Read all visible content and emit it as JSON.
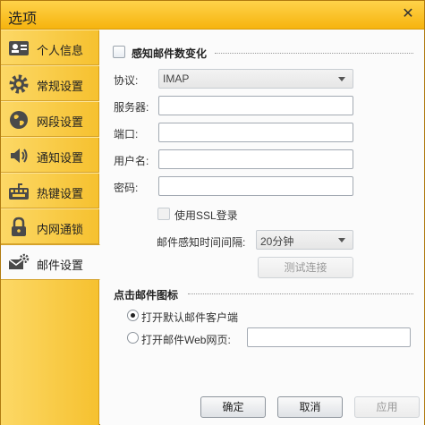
{
  "window": {
    "title": "选项",
    "close_glyph": "✕"
  },
  "sidebar": {
    "items": [
      {
        "label": "个人信息",
        "icon": "id-card-icon"
      },
      {
        "label": "常规设置",
        "icon": "gear-icon"
      },
      {
        "label": "网段设置",
        "icon": "globe-icon"
      },
      {
        "label": "通知设置",
        "icon": "speaker-icon"
      },
      {
        "label": "热键设置",
        "icon": "keyboard-icon"
      },
      {
        "label": "内网通锁",
        "icon": "lock-icon"
      },
      {
        "label": "邮件设置",
        "icon": "mail-gear-icon",
        "active": true
      }
    ]
  },
  "mail": {
    "detect_label": "感知邮件数变化",
    "protocol_label": "协议:",
    "protocol_value": "IMAP",
    "server_label": "服务器:",
    "server_value": "",
    "port_label": "端口:",
    "port_value": "",
    "username_label": "用户名:",
    "username_value": "",
    "password_label": "密码:",
    "password_value": "",
    "ssl_label": "使用SSL登录",
    "interval_label": "邮件感知时间间隔:",
    "interval_value": "20分钟",
    "test_button": "测试连接"
  },
  "click_icon": {
    "title": "点击邮件图标",
    "option_default": "打开默认邮件客户端",
    "option_web": "打开邮件Web网页:",
    "web_value": ""
  },
  "footer": {
    "ok": "确定",
    "cancel": "取消",
    "apply": "应用"
  },
  "colors": {
    "accent": "#f6b40e",
    "sidebar": "#fcd866"
  }
}
